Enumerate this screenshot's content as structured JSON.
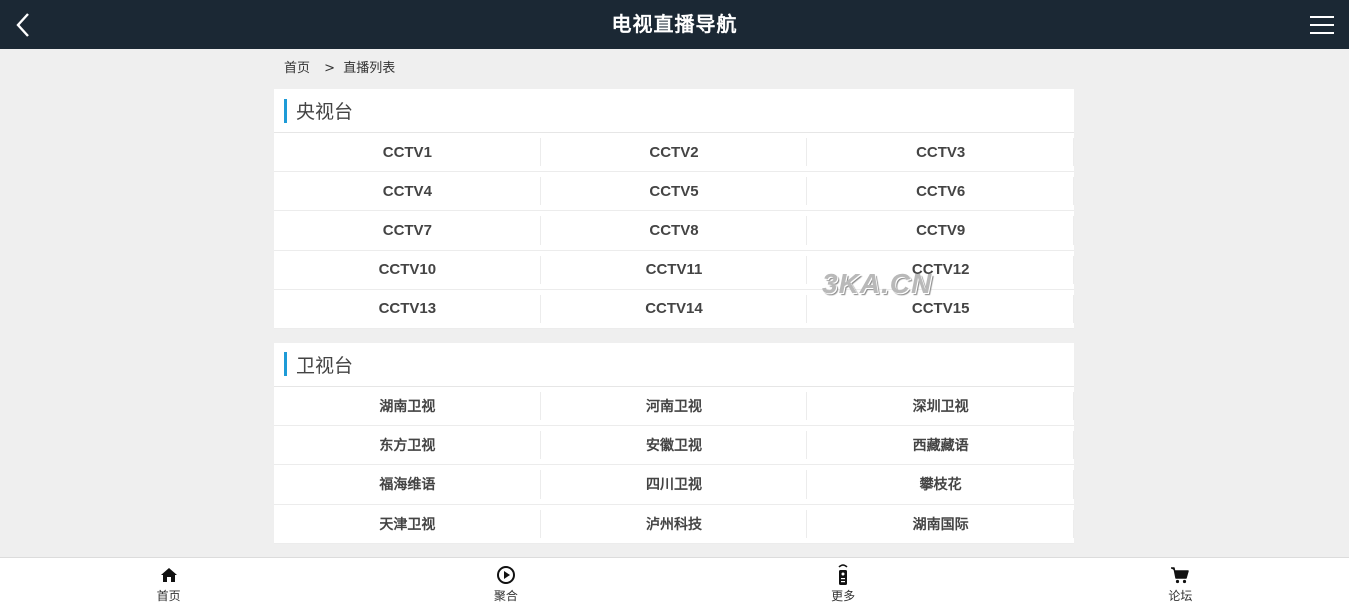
{
  "header": {
    "title": "电视直播导航",
    "back_icon": "chevron-left-icon",
    "menu_icon": "hamburger-menu-icon"
  },
  "breadcrumb": {
    "home": "首页",
    "separator": ">",
    "current": "直播列表"
  },
  "sections": [
    {
      "title": "央视台",
      "channels": [
        "CCTV1",
        "CCTV2",
        "CCTV3",
        "CCTV4",
        "CCTV5",
        "CCTV6",
        "CCTV7",
        "CCTV8",
        "CCTV9",
        "CCTV10",
        "CCTV11",
        "CCTV12",
        "CCTV13",
        "CCTV14",
        "CCTV15"
      ]
    },
    {
      "title": "卫视台",
      "channels": [
        "湖南卫视",
        "河南卫视",
        "深圳卫视",
        "东方卫视",
        "安徽卫视",
        "西藏藏语",
        "福海维语",
        "四川卫视",
        "攀枝花",
        "天津卫视",
        "泸州科技",
        "湖南国际"
      ]
    }
  ],
  "watermark": "3KA.CN",
  "bottom_nav": [
    {
      "label": "首页",
      "icon": "home-icon"
    },
    {
      "label": "聚合",
      "icon": "play-circle-icon"
    },
    {
      "label": "更多",
      "icon": "remote-control-icon"
    },
    {
      "label": "论坛",
      "icon": "cart-icon"
    }
  ],
  "colors": {
    "header_bg": "#1b2834",
    "accent": "#1e9bd7",
    "page_bg": "#efefef"
  }
}
